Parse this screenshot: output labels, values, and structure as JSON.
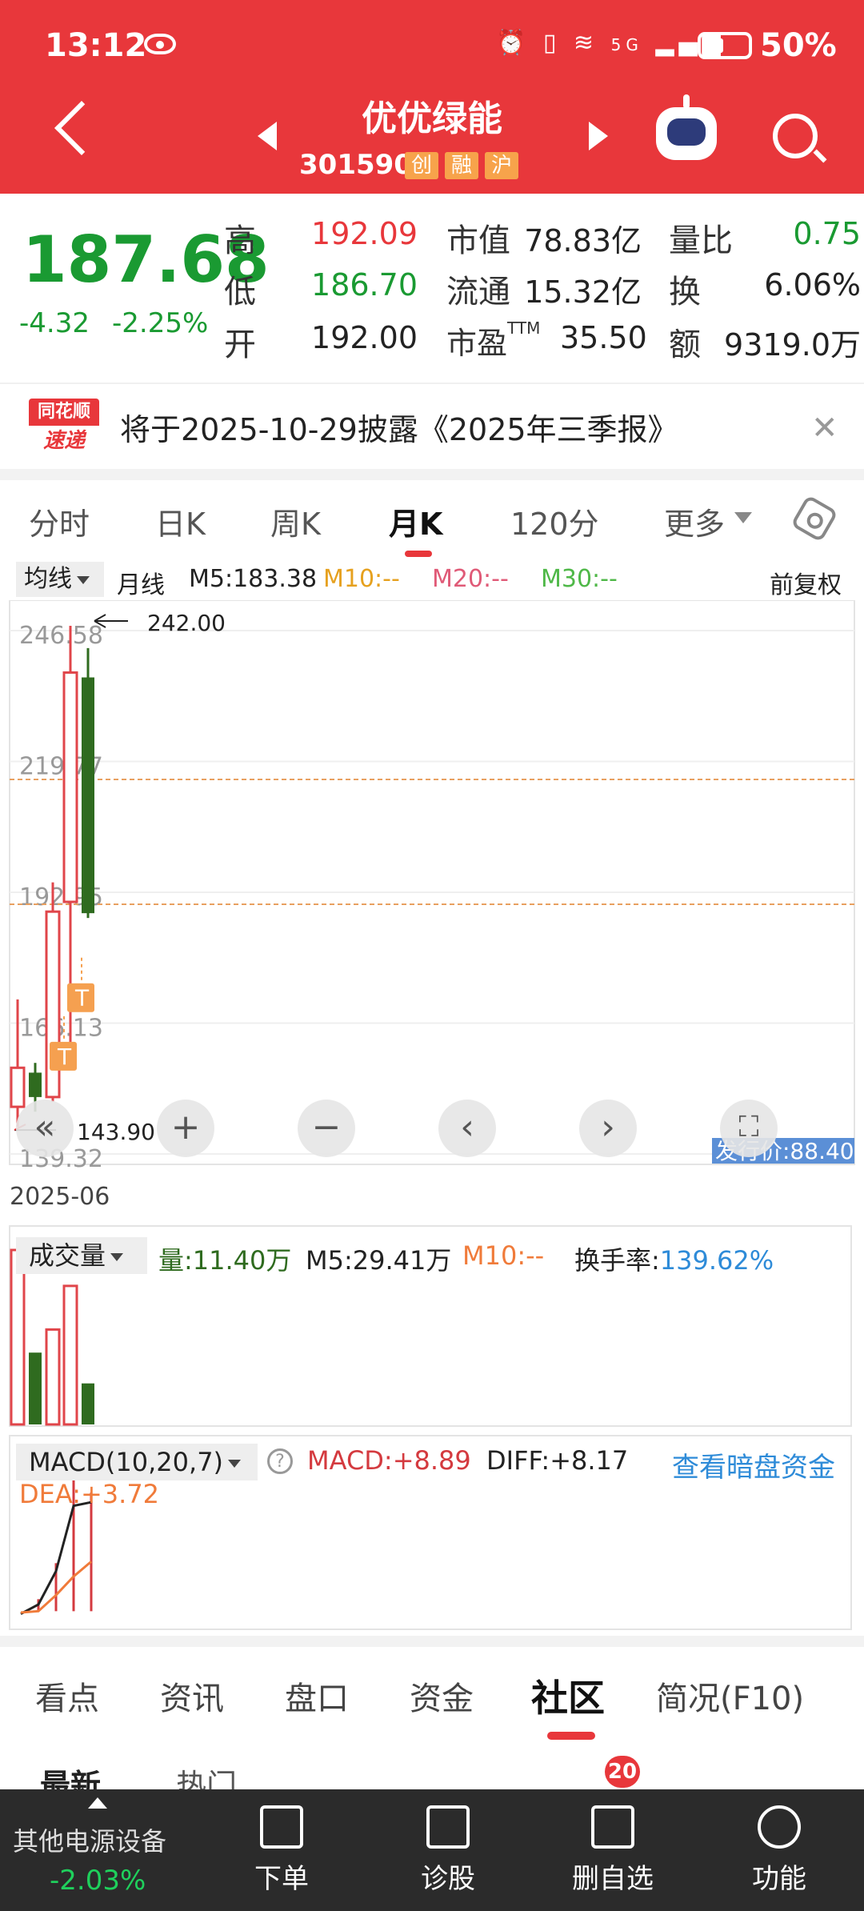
{
  "status_bar": {
    "time": "13:12",
    "battery": "50%",
    "network": "5G"
  },
  "header": {
    "title": "优优绿能",
    "code": "301590",
    "tags": [
      "创",
      "融",
      "沪"
    ]
  },
  "quote": {
    "price": "187.68",
    "change": "-4.32",
    "change_pct": "-2.25%",
    "rows": [
      {
        "l1": "高",
        "v1": "192.09",
        "l2": "市值",
        "v2": "78.83亿",
        "l3": "量比",
        "v3": "0.75"
      },
      {
        "l1": "低",
        "v1": "186.70",
        "l2": "流通",
        "v2": "15.32亿",
        "l3": "换",
        "v3": "6.06%"
      },
      {
        "l1": "开",
        "v1": "192.00",
        "l2": "市盈TTM",
        "v2": "35.50",
        "l3": "额",
        "v3": "9319.0万"
      }
    ]
  },
  "notice": {
    "logo_top": "同花顺",
    "logo_bottom": "速递",
    "text": "将于2025-10-29披露《2025年三季报》"
  },
  "chart_tabs": {
    "items": [
      "分时",
      "日K",
      "周K",
      "月K",
      "120分",
      "更多"
    ],
    "active": "月K"
  },
  "indicator": {
    "selector": "均线",
    "label": "月线",
    "m5": "M5:183.38",
    "m10": "M10:--",
    "m20": "M20:--",
    "m30": "M30:--",
    "adjust": "前复权"
  },
  "kline": {
    "price_labels": [
      "246.58",
      "219.77",
      "192.95",
      "166.13",
      "139.32"
    ],
    "high_marker": "242.00",
    "low_marker": "143.90",
    "issue_price": "发行价:88.40",
    "date": "2025-06",
    "tag_t": "T"
  },
  "chart_data": {
    "type": "candlestick",
    "period": "月K",
    "y_range": [
      139.32,
      246.58
    ],
    "y_ticks": [
      246.58,
      219.77,
      192.95,
      166.13,
      139.32
    ],
    "candles": [
      {
        "open": 148.0,
        "close": 156.0,
        "high": 170.0,
        "low": 143.9,
        "dir": "up"
      },
      {
        "open": 155.0,
        "close": 150.0,
        "high": 157.0,
        "low": 147.0,
        "dir": "down"
      },
      {
        "open": 150.0,
        "close": 188.0,
        "high": 194.0,
        "low": 149.0,
        "dir": "up"
      },
      {
        "open": 190.0,
        "close": 237.0,
        "high": 246.58,
        "low": 160.0,
        "dir": "up"
      },
      {
        "open": 236.0,
        "close": 187.68,
        "high": 242.0,
        "low": 186.7,
        "dir": "down"
      }
    ],
    "reference_lines": [
      215.1,
      189.5
    ],
    "volume": {
      "label": "成交量",
      "current": "量:11.40万",
      "m5": "M5:29.41万",
      "m10": "M10:--",
      "turnover": "换手率:139.62%",
      "bars": [
        {
          "value": 34.0,
          "dir": "up"
        },
        {
          "value": 14.0,
          "dir": "down"
        },
        {
          "value": 18.5,
          "dir": "up"
        },
        {
          "value": 27.0,
          "dir": "up"
        },
        {
          "value": 8.0,
          "dir": "down"
        }
      ]
    },
    "macd": {
      "label": "MACD(10,20,7)",
      "macd": "MACD:+8.89",
      "diff": "DIFF:+8.17",
      "dea": "DEA:+3.72",
      "link": "查看暗盘资金",
      "diff_line": [
        -0.2,
        0.5,
        3.0,
        7.9,
        8.17
      ],
      "dea_line": [
        -0.1,
        0.0,
        1.2,
        2.6,
        3.72
      ],
      "bars": [
        0.0,
        0.9,
        3.6,
        10.6,
        8.89
      ]
    }
  },
  "bottom_tabs": {
    "items": [
      "看点",
      "资讯",
      "盘口",
      "资金",
      "社区",
      "简况(F10)"
    ],
    "active": "社区"
  },
  "sub_tabs": {
    "items": [
      "最新",
      "热门"
    ],
    "badge": "20"
  },
  "nav": {
    "sector": "其他电源设备",
    "sector_change": "-2.03%",
    "items": [
      "下单",
      "诊股",
      "删自选",
      "功能"
    ]
  },
  "colors": {
    "brand_red": "#e8373b",
    "up": "#e0454a",
    "down": "#2f6b1f",
    "green_text": "#1a9a32",
    "link": "#2e8bd8"
  }
}
